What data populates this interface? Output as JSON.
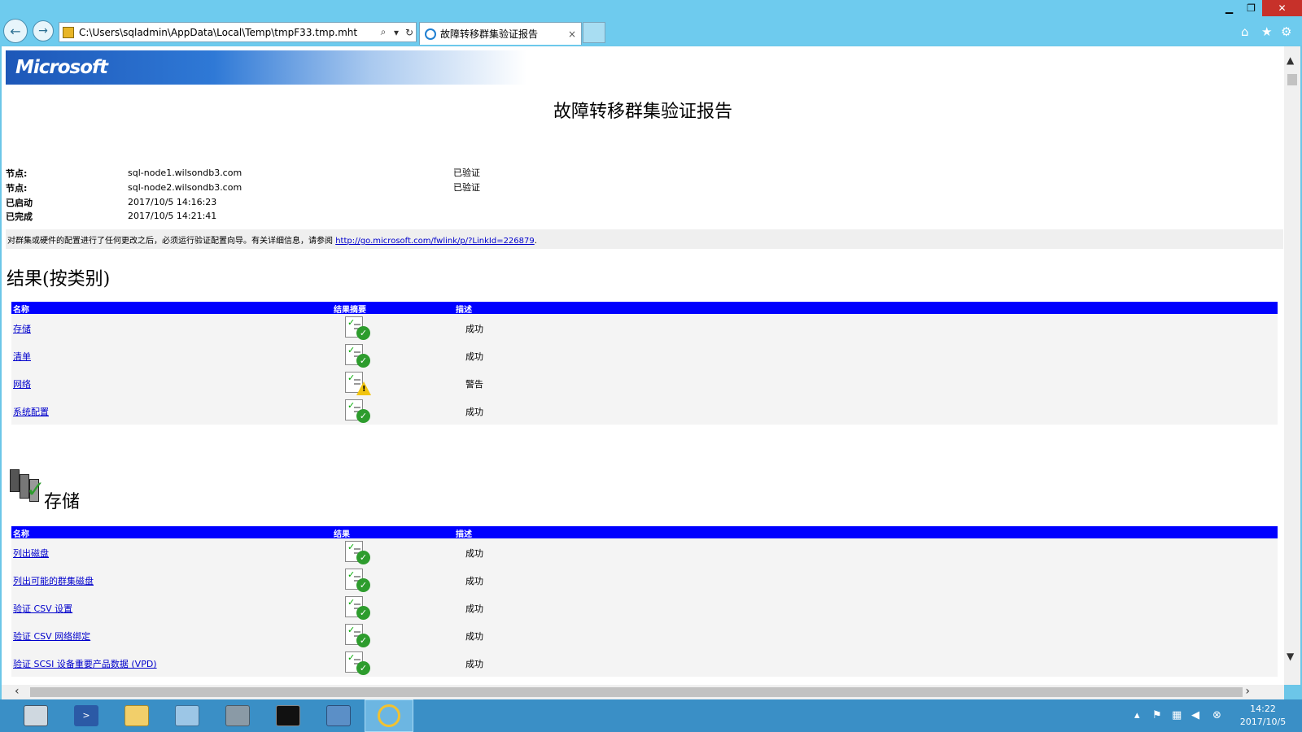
{
  "browser": {
    "address": "C:\\Users\\sqladmin\\AppData\\Local\\Temp\\tmpF33.tmp.mht",
    "tab_title": "故障转移群集验证报告",
    "tab_close": "×"
  },
  "report": {
    "logo": "Microsoft",
    "title": "故障转移群集验证报告",
    "info": [
      {
        "label": "节点:",
        "value": "sql-node1.wilsondb3.com",
        "status": "已验证"
      },
      {
        "label": "节点:",
        "value": "sql-node2.wilsondb3.com",
        "status": "已验证"
      },
      {
        "label": "已启动",
        "value": "2017/10/5 14:16:23",
        "status": ""
      },
      {
        "label": "已完成",
        "value": "2017/10/5 14:21:41",
        "status": ""
      }
    ],
    "note_text": "对群集或硬件的配置进行了任何更改之后，必须运行验证配置向导。有关详细信息，请参阅 ",
    "note_link": "http://go.microsoft.com/fwlink/p/?LinkId=226879",
    "note_end": "."
  },
  "results_by_category": {
    "heading": "结果(按类别)",
    "columns": [
      "名称",
      "结果摘要",
      "描述"
    ],
    "rows": [
      {
        "name": "存储",
        "result": "ok",
        "desc": "成功"
      },
      {
        "name": "清单",
        "result": "ok",
        "desc": "成功"
      },
      {
        "name": "网络",
        "result": "warn",
        "desc": "警告"
      },
      {
        "name": "系统配置",
        "result": "ok",
        "desc": "成功"
      }
    ]
  },
  "storage": {
    "heading": "存储",
    "columns": [
      "名称",
      "结果",
      "描述"
    ],
    "rows": [
      {
        "name": "列出磁盘",
        "result": "ok",
        "desc": "成功"
      },
      {
        "name": "列出可能的群集磁盘",
        "result": "ok",
        "desc": "成功"
      },
      {
        "name": "验证 CSV 设置",
        "result": "ok",
        "desc": "成功"
      },
      {
        "name": "验证 CSV 网络绑定",
        "result": "ok",
        "desc": "成功"
      },
      {
        "name": "验证 SCSI 设备重要产品数据 (VPD)",
        "result": "ok",
        "desc": "成功"
      }
    ]
  },
  "taskbar": {
    "time": "14:22",
    "date": "2017/10/5"
  },
  "colors": {
    "table_header": "#0000ff",
    "link": "#0000cc",
    "taskbar": "#3a8fc6",
    "chrome": "#6ecbee"
  }
}
